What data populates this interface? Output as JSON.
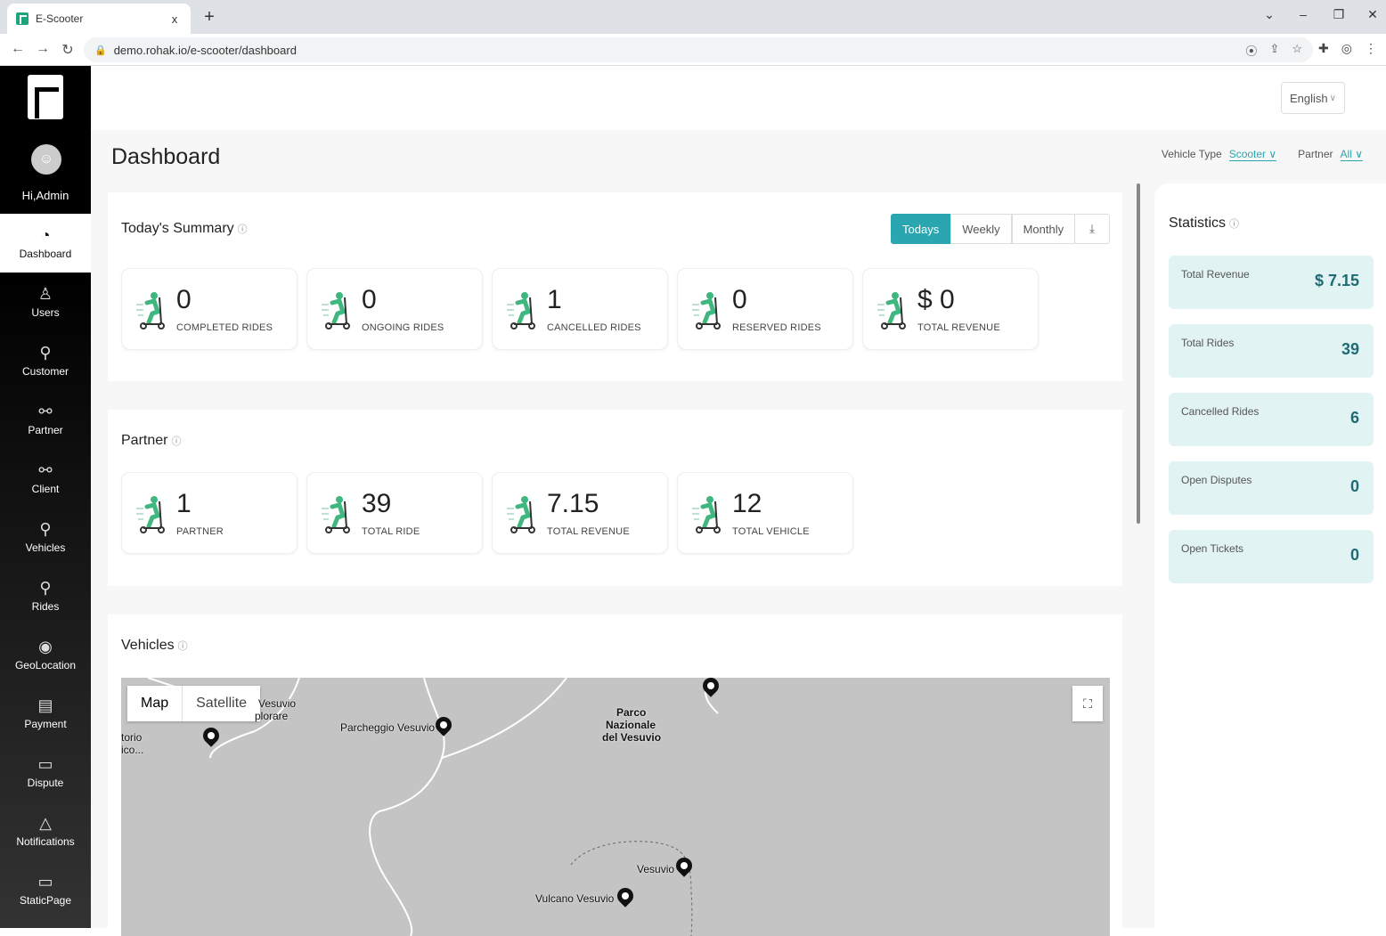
{
  "browser": {
    "tab_title": "E-Scooter",
    "tab_close": "x",
    "new_tab": "+",
    "url": "demo.rohak.io/e-scooter/dashboard"
  },
  "sidebar": {
    "greeting": "Hi,Admin",
    "items": [
      {
        "label": "Dashboard",
        "icon": "gauge-icon",
        "glyph": "◔",
        "active": true
      },
      {
        "label": "Users",
        "icon": "users-icon",
        "glyph": "♙"
      },
      {
        "label": "Customer",
        "icon": "scooter-icon",
        "glyph": "⚲"
      },
      {
        "label": "Partner",
        "icon": "handshake-icon",
        "glyph": "⚯"
      },
      {
        "label": "Client",
        "icon": "handshake-icon",
        "glyph": "⚯"
      },
      {
        "label": "Vehicles",
        "icon": "scooter-icon",
        "glyph": "⚲"
      },
      {
        "label": "Rides",
        "icon": "scooter-icon",
        "glyph": "⚲"
      },
      {
        "label": "GeoLocation",
        "icon": "map-pin-icon",
        "glyph": "◉"
      },
      {
        "label": "Payment",
        "icon": "payment-icon",
        "glyph": "▤"
      },
      {
        "label": "Dispute",
        "icon": "chat-icon",
        "glyph": "▭"
      },
      {
        "label": "Notifications",
        "icon": "bell-icon",
        "glyph": "△"
      },
      {
        "label": "StaticPage",
        "icon": "monitor-icon",
        "glyph": "▭"
      }
    ]
  },
  "header": {
    "language": "English"
  },
  "page": {
    "title": "Dashboard",
    "filters": {
      "vehicle_type_label": "Vehicle Type",
      "vehicle_type_value": "Scooter",
      "partner_label": "Partner",
      "partner_value": "All"
    }
  },
  "summary": {
    "title": "Today's Summary",
    "periods": [
      "Todays",
      "Weekly",
      "Monthly"
    ],
    "active_period": "Todays",
    "download_icon": "download-icon",
    "cards": [
      {
        "value": "0",
        "label": "COMPLETED RIDES"
      },
      {
        "value": "0",
        "label": "ONGOING RIDES"
      },
      {
        "value": "1",
        "label": "CANCELLED RIDES"
      },
      {
        "value": "0",
        "label": "RESERVED RIDES"
      },
      {
        "value": "$ 0",
        "label": "TOTAL REVENUE"
      }
    ]
  },
  "partner": {
    "title": "Partner",
    "cards": [
      {
        "value": "1",
        "label": "PARTNER"
      },
      {
        "value": "39",
        "label": "TOTAL RIDE"
      },
      {
        "value": "7.15",
        "label": "TOTAL REVENUE"
      },
      {
        "value": "12",
        "label": "TOTAL VEHICLE"
      }
    ]
  },
  "vehicles": {
    "title": "Vehicles",
    "map_type": [
      "Map",
      "Satellite"
    ],
    "labels": {
      "vesuvio_top": "Vesuvio",
      "esplorare": "plorare",
      "osservatorio": "torio",
      "osservatorio2": "ico...",
      "parcheggio": "Parcheggio Vesuvio",
      "parco": "Parco",
      "parco2": "Nazionale",
      "parco3": "del Vesuvio",
      "vesuvio_peak": "Vesuvio",
      "vulcano": "Vulcano Vesuvio"
    }
  },
  "statistics": {
    "title": "Statistics",
    "items": [
      {
        "label": "Total Revenue",
        "value": "$ 7.15"
      },
      {
        "label": "Total Rides",
        "value": "39"
      },
      {
        "label": "Cancelled Rides",
        "value": "6"
      },
      {
        "label": "Open Disputes",
        "value": "0"
      },
      {
        "label": "Open Tickets",
        "value": "0"
      }
    ]
  },
  "colors": {
    "accent": "#2aa6b0",
    "stat_bg": "#e2f3f4",
    "stat_value": "#1f6a73",
    "scooter_green": "#3fb77f"
  }
}
